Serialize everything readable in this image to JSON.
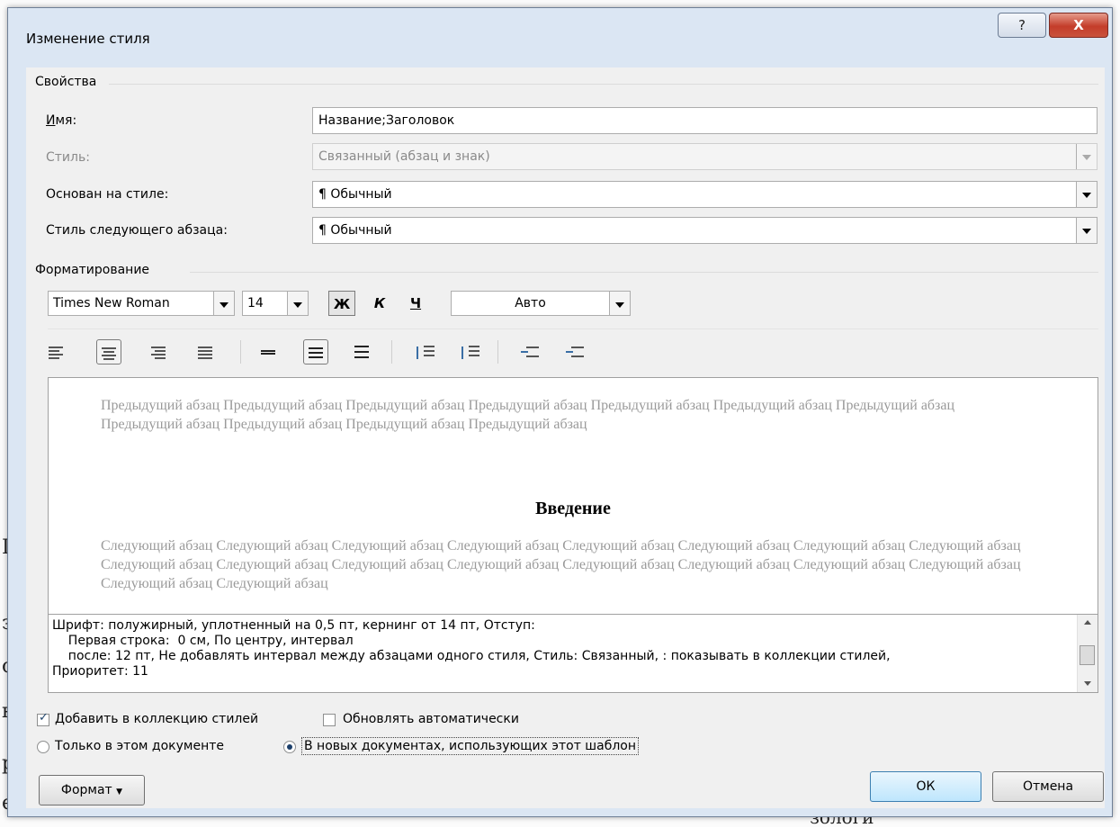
{
  "dialog": {
    "title": "Изменение стиля",
    "help_glyph": "?",
    "close_glyph": "X"
  },
  "properties": {
    "section_label": "Свойства",
    "name_label": "Имя:",
    "name_value": "Название;Заголовок",
    "style_label": "Стиль:",
    "style_value": "Связанный (абзац и знак)",
    "based_on_label": "Основан на стиле:",
    "based_on_value": "¶  Обычный",
    "next_style_label": "Стиль следующего абзаца:",
    "next_style_value": "¶  Обычный"
  },
  "formatting": {
    "section_label": "Форматирование",
    "font_name": "Times New Roman",
    "font_size": "14",
    "bold_glyph": "Ж",
    "italic_glyph": "К",
    "underline_glyph": "Ч",
    "color_value": "Авто"
  },
  "preview": {
    "previous_paragraph": "Предыдущий абзац Предыдущий абзац Предыдущий абзац Предыдущий абзац Предыдущий абзац Предыдущий абзац Предыдущий абзац Предыдущий абзац Предыдущий абзац Предыдущий абзац Предыдущий абзац",
    "heading": "Введение",
    "next_paragraph": "Следующий абзац Следующий абзац Следующий абзац Следующий абзац Следующий абзац Следующий абзац Следующий абзац Следующий абзац Следующий абзац Следующий абзац Следующий абзац Следующий абзац Следующий абзац Следующий абзац Следующий абзац Следующий абзац Следующий абзац Следующий абзац"
  },
  "description": {
    "line1": "Шрифт: полужирный, уплотненный на  0,5 пт, кернинг от 14 пт, Отступ:",
    "line2": "    Первая строка:  0 см, По центру, интервал",
    "line3": "    после: 12 пт, Не добавлять интервал между абзацами одного стиля, Стиль: Связанный, : показывать в коллекции стилей,",
    "line4": "Приоритет: 11"
  },
  "options": {
    "add_to_gallery": "Добавить в коллекцию стилей",
    "auto_update": "Обновлять автоматически",
    "only_this_doc": "Только в этом документе",
    "new_docs": "В новых документах, использующих этот шаблон"
  },
  "buttons": {
    "format": "Формат",
    "ok": "ОК",
    "cancel": "Отмена"
  },
  "background_doc": {
    "bottom_text": "зологи"
  },
  "colors": {
    "dialog_frame": "#dbe6f3",
    "client": "#f0f0f0",
    "close_red": "#c43d2a",
    "ok_blue": "#bee6fd",
    "preview_gray_text": "#9a9a9a"
  }
}
